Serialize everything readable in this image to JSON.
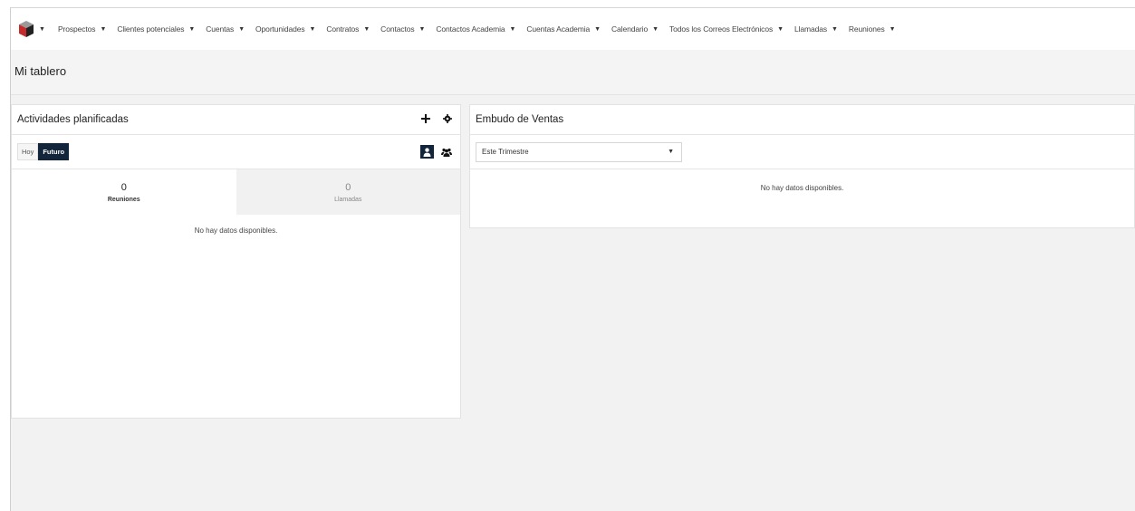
{
  "nav": {
    "items": [
      {
        "label": "Prospectos"
      },
      {
        "label": "Clientes potenciales"
      },
      {
        "label": "Cuentas"
      },
      {
        "label": "Oportunidades"
      },
      {
        "label": "Contratos"
      },
      {
        "label": "Contactos"
      },
      {
        "label": "Contactos Academia"
      },
      {
        "label": "Cuentas Academia"
      },
      {
        "label": "Calendario"
      },
      {
        "label": "Todos los Correos Electrónicos"
      },
      {
        "label": "Llamadas"
      },
      {
        "label": "Reuniones"
      }
    ],
    "caret": "▼"
  },
  "page": {
    "title": "Mi tablero"
  },
  "activities": {
    "title": "Actividades planificadas",
    "filters": {
      "today": "Hoy",
      "future": "Futuro"
    },
    "tabs": [
      {
        "count": "0",
        "label": "Reuniones"
      },
      {
        "count": "0",
        "label": "Llamadas"
      }
    ],
    "no_data": "No hay datos disponibles."
  },
  "pipeline": {
    "title": "Embudo de Ventas",
    "period": "Este Trimestre",
    "no_data": "No hay datos disponibles."
  },
  "colors": {
    "accent": "#13253b",
    "logo_red": "#c62b2b"
  }
}
